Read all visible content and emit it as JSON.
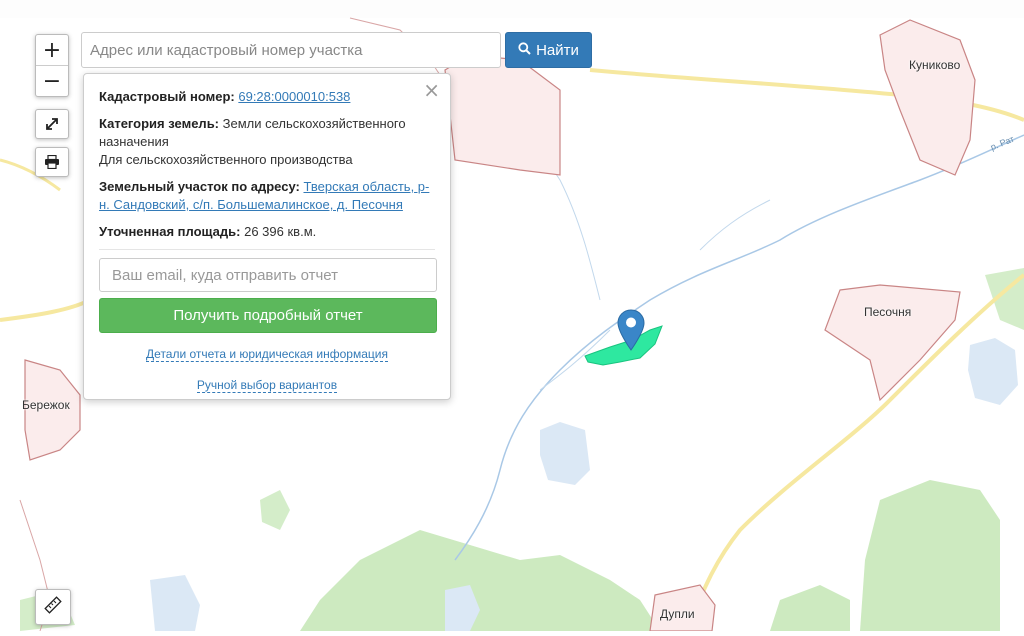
{
  "search": {
    "placeholder": "Адрес или кадастровый номер участка",
    "button_label": "Найти"
  },
  "controls": {
    "zoom_in": "+",
    "zoom_out": "−"
  },
  "popup": {
    "close": "×",
    "cadastral_label": "Кадастровый номер:",
    "cadastral_value": "69:28:0000010:538",
    "category_label": "Категория земель:",
    "category_value": "Земли сельскохозяйственного назначения",
    "usage": "Для сельскохозяйственного производства",
    "address_label": "Земельный участок по адресу:",
    "address_value": "Тверская область, р-н. Сандовский, с/п. Большемалинское, д. Песочня",
    "area_label": "Уточненная площадь:",
    "area_value": "26 396 кв.м.",
    "email_placeholder": "Ваш email, куда отправить отчет",
    "report_button": "Получить подробный отчет",
    "details_link": "Детали отчета и юридическая информация",
    "manual_link": "Ручной выбор вариантов"
  },
  "map": {
    "places": {
      "kunikovo": "Куниково",
      "pesochnya": "Песочня",
      "berezhok": "Бережок",
      "dupli": "Дупли"
    },
    "river": "р. Рат"
  },
  "colors": {
    "plot": "#2ee8a0",
    "marker": "#3a86c8",
    "search_button": "#337ab7",
    "report_button": "#5cb85c"
  }
}
